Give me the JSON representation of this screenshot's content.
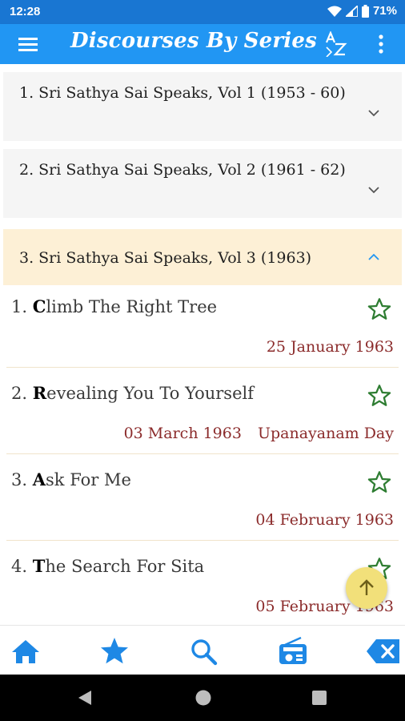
{
  "status": {
    "time": "12:28",
    "battery": "71%"
  },
  "appbar": {
    "title": "Discourses By Series"
  },
  "series": [
    {
      "label": "1. Sri Sathya Sai Speaks, Vol 1 (1953 - 60)"
    },
    {
      "label": "2. Sri Sathya Sai Speaks, Vol 2 (1961 - 62)"
    },
    {
      "label": "3. Sri Sathya Sai Speaks, Vol 3 (1963)"
    }
  ],
  "discourses": [
    {
      "num": "1. ",
      "initial": "C",
      "rest": "limb The Right Tree",
      "date": "25 January 1963",
      "occasion": ""
    },
    {
      "num": "2. ",
      "initial": "R",
      "rest": "evealing You To Yourself",
      "date": "03 March 1963",
      "occasion": "Upanayanam Day"
    },
    {
      "num": "3. ",
      "initial": "A",
      "rest": "sk For Me",
      "date": "04 February 1963",
      "occasion": ""
    },
    {
      "num": "4. ",
      "initial": "T",
      "rest": "he Search For Sita",
      "date": "05 February 1963",
      "occasion": ""
    }
  ],
  "bottom_nav": [
    "home-icon",
    "star-icon",
    "search-icon",
    "radio-icon",
    "backspace-icon"
  ],
  "colors": {
    "primary": "#2196f3",
    "status_bar": "#1976d2",
    "date_text": "#8b2b2b",
    "star_outline": "#2e7d32",
    "expanded_header": "#fdf0d6",
    "fab": "#f2e07a"
  }
}
